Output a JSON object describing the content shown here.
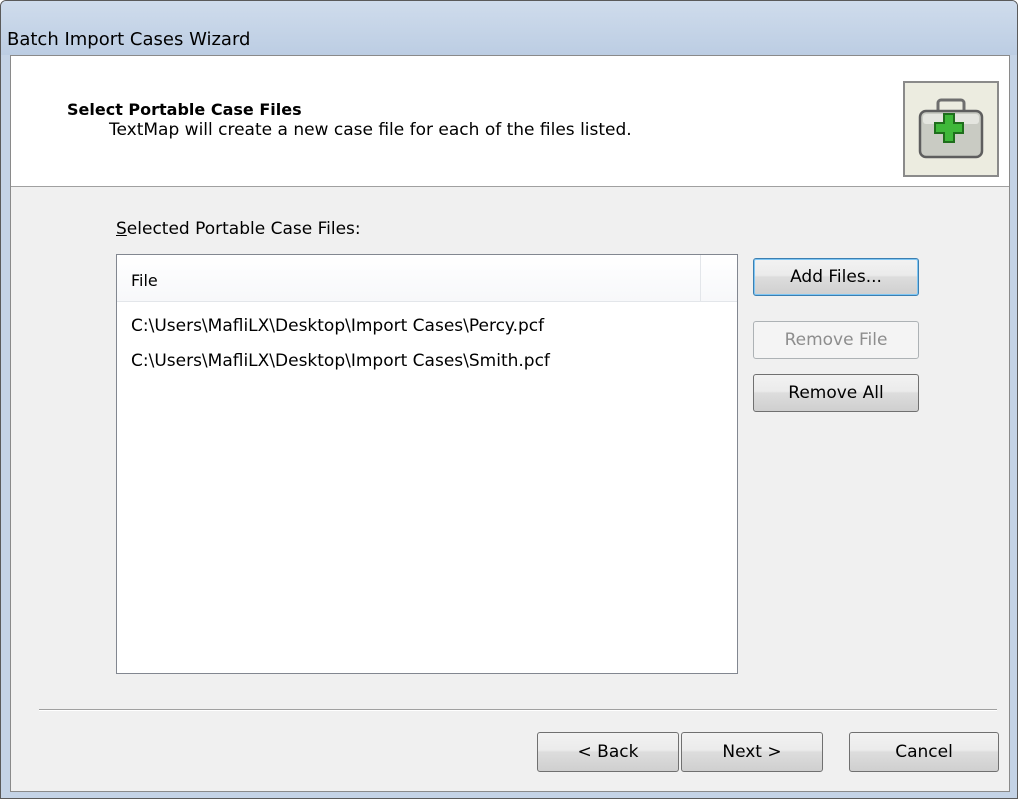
{
  "window": {
    "title": "Batch Import Cases Wizard"
  },
  "header": {
    "title": "Select Portable Case Files",
    "subtitle": "TextMap will create a new case file for each of the files listed.",
    "icon": "medical-case-plus-icon"
  },
  "files_section": {
    "label_mnemonic": "S",
    "label_rest": "elected Portable Case Files:",
    "columns": [
      "File",
      ""
    ],
    "rows": [
      "C:\\Users\\MafliLX\\Desktop\\Import Cases\\Percy.pcf",
      "C:\\Users\\MafliLX\\Desktop\\Import Cases\\Smith.pcf"
    ]
  },
  "side_buttons": {
    "add_files": "Add Files...",
    "remove_file": "Remove File",
    "remove_all": "Remove All"
  },
  "footer_buttons": {
    "back": "< Back",
    "next": "Next >",
    "cancel": "Cancel"
  },
  "colors": {
    "icon_case": "#b8b8b0",
    "icon_cross": "#3fb83a"
  }
}
